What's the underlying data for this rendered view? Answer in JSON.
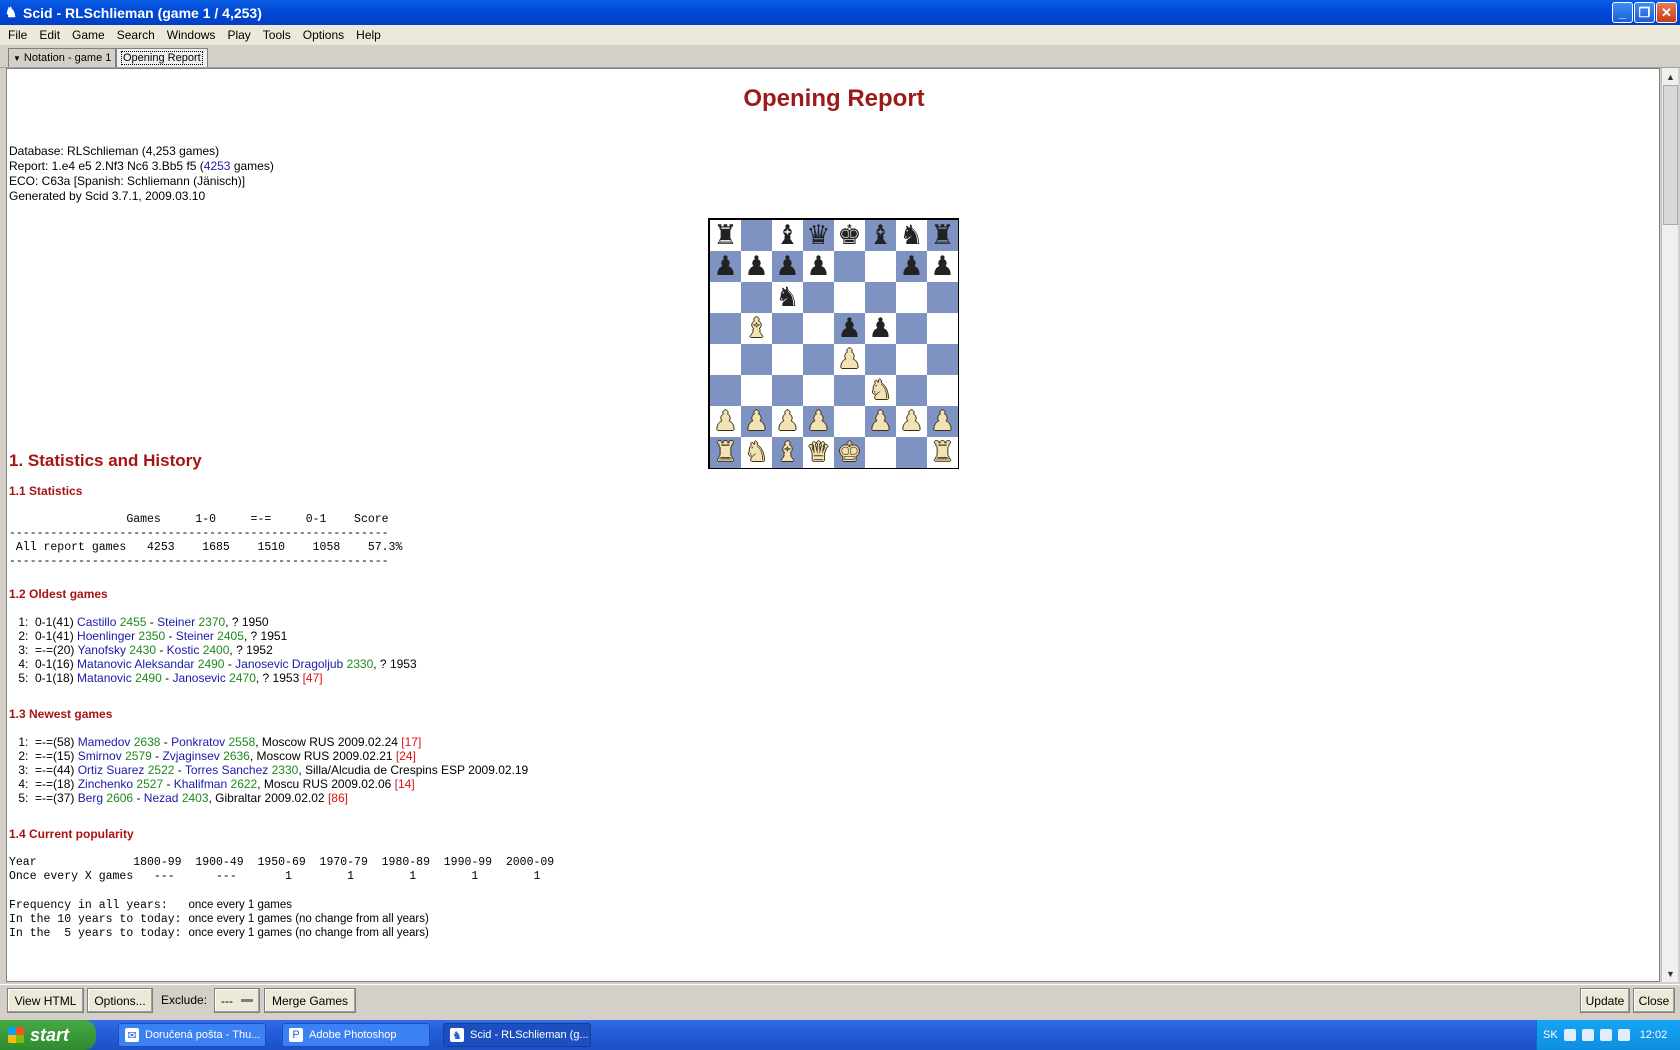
{
  "window": {
    "title": "Scid - RLSchlieman (game 1 / 4,253)"
  },
  "menu": [
    "File",
    "Edit",
    "Game",
    "Search",
    "Windows",
    "Play",
    "Tools",
    "Options",
    "Help"
  ],
  "tabs": [
    {
      "label": "Notation - game 1"
    },
    {
      "label": "Opening Report"
    }
  ],
  "report": {
    "title": "Opening Report",
    "database": "Database: RLSchlieman (4,253 games)",
    "report_prefix": "Report:  1.e4 e5 2.Nf3 Nc6 3.Bb5 f5 (",
    "report_games": "4253",
    "report_suffix": " games)",
    "eco": "ECO: C63a [Spanish: Schliemann (Jänisch)]",
    "generated": "Generated by Scid 3.7.1, 2009.03.10"
  },
  "board": {
    "ranks": [
      [
        "bR",
        "",
        "bB",
        "bQ",
        "bK",
        "bB",
        "bN",
        "bR"
      ],
      [
        "bP",
        "bP",
        "bP",
        "bP",
        "",
        "",
        "bP",
        "bP"
      ],
      [
        "",
        "",
        "bN",
        "",
        "",
        "",
        "",
        ""
      ],
      [
        "",
        "wB",
        "",
        "",
        "bP",
        "bP",
        "",
        ""
      ],
      [
        "",
        "",
        "",
        "",
        "wP",
        "",
        "",
        ""
      ],
      [
        "",
        "",
        "",
        "",
        "",
        "wN",
        "",
        ""
      ],
      [
        "wP",
        "wP",
        "wP",
        "wP",
        "",
        "wP",
        "wP",
        "wP"
      ],
      [
        "wR",
        "wN",
        "wB",
        "wQ",
        "wK",
        "",
        "",
        "wR"
      ]
    ]
  },
  "sections": {
    "s1": "1. Statistics and History",
    "s11": "1.1 Statistics",
    "s12": "1.2 Oldest games",
    "s13": "1.3 Newest games",
    "s14": "1.4 Current popularity"
  },
  "stats": {
    "header": "                 Games     1-0     =-=     0-1    Score",
    "rule": "-------------------------------------------------------",
    "row": " All report games   4253    1685    1510    1058    57.3%"
  },
  "oldest": [
    {
      "n": " 1:  0-1(41) ",
      "w": "Castillo",
      "we": "2455",
      "b": "Steiner",
      "be": "2370",
      "tail": ", ? 1950",
      "ref": ""
    },
    {
      "n": " 2:  0-1(41) ",
      "w": "Hoenlinger",
      "we": "2350",
      "b": "Steiner",
      "be": "2405",
      "tail": ", ? 1951",
      "ref": ""
    },
    {
      "n": " 3:  =-=(20) ",
      "w": "Yanofsky",
      "we": "2430",
      "b": "Kostic",
      "be": "2400",
      "tail": ", ? 1952",
      "ref": ""
    },
    {
      "n": " 4:  0-1(16) ",
      "w": "Matanovic Aleksandar",
      "we": "2490",
      "b": "Janosevic Dragoljub",
      "be": "2330",
      "tail": ", ? 1953",
      "ref": ""
    },
    {
      "n": " 5:  0-1(18) ",
      "w": "Matanovic",
      "we": "2490",
      "b": "Janosevic",
      "be": "2470",
      "tail": ", ? 1953 ",
      "ref": "[47]"
    }
  ],
  "newest": [
    {
      "n": " 1:  =-=(58) ",
      "w": "Mamedov",
      "we": "2638",
      "b": "Ponkratov",
      "be": "2558",
      "tail": ", Moscow RUS 2009.02.24 ",
      "ref": "[17]"
    },
    {
      "n": " 2:  =-=(15) ",
      "w": "Smirnov",
      "we": "2579",
      "b": "Zvjaginsev",
      "be": "2636",
      "tail": ", Moscow RUS 2009.02.21 ",
      "ref": "[24]"
    },
    {
      "n": " 3:  =-=(44) ",
      "w": "Ortiz Suarez",
      "we": "2522",
      "b": "Torres Sanchez",
      "be": "2330",
      "tail": ", Silla/Alcudia de Crespins ESP 2009.02.19",
      "ref": ""
    },
    {
      "n": " 4:  =-=(18) ",
      "w": "Zinchenko",
      "we": "2527",
      "b": "Khalifman",
      "be": "2622",
      "tail": ", Moscu RUS 2009.02.06 ",
      "ref": "[14]"
    },
    {
      "n": " 5:  =-=(37) ",
      "w": "Berg",
      "we": "2606",
      "b": "Nezad",
      "be": "2403",
      "tail": ", Gibraltar 2009.02.02 ",
      "ref": "[86]"
    }
  ],
  "popularity": {
    "year_row": "Year              1800-99  1900-49  1950-69  1970-79  1980-89  1990-99  2000-09",
    "once_row": "Once every X games   ---      ---       1        1        1        1        1",
    "freq1": "Frequency in all years:   ",
    "freq1v": "once every 1 games",
    "freq2": "In the 10 years to today: ",
    "freq2v": "once every 1 games (no change from all years)",
    "freq3": "In the  5 years to today: ",
    "freq3v": "once every 1 games (no change from all years)"
  },
  "bottom": {
    "view_html": "View HTML",
    "options": "Options...",
    "exclude_label": "Exclude:",
    "exclude_value": "---",
    "merge": "Merge Games",
    "update": "Update",
    "close": "Close"
  },
  "taskbar": {
    "start": "start",
    "tasks": [
      "Doručená pošta - Thu...",
      "Adobe Photoshop",
      "Scid - RLSchlieman (g..."
    ],
    "lang": "SK",
    "clock": "12:02"
  }
}
